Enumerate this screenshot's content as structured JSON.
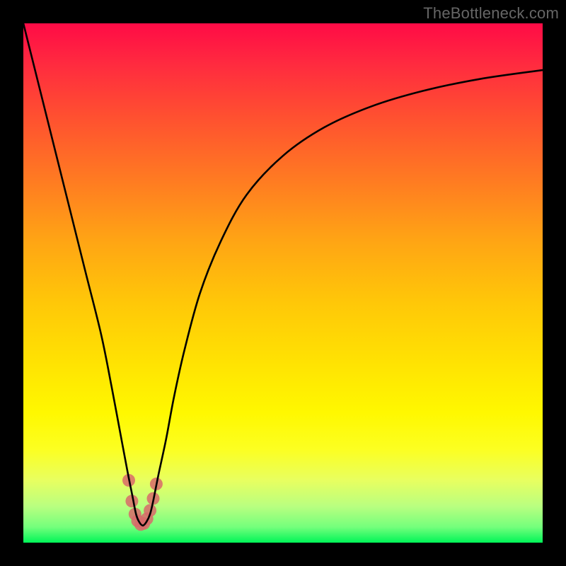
{
  "watermark": "TheBottleneck.com",
  "colors": {
    "frame_bg": "#000000",
    "curve_stroke": "#000000",
    "marker_fill": "#d86a6a",
    "marker_stroke": "#d86a6a"
  },
  "chart_data": {
    "type": "line",
    "title": "",
    "xlabel": "",
    "ylabel": "",
    "xlim": [
      0,
      100
    ],
    "ylim": [
      0,
      100
    ],
    "grid": false,
    "series": [
      {
        "name": "bottleneck-curve",
        "x": [
          0.0,
          3.0,
          6.0,
          9.0,
          12.0,
          15.0,
          17.0,
          18.5,
          20.0,
          21.0,
          21.7,
          22.3,
          23.0,
          23.7,
          24.4,
          25.0,
          26.0,
          27.5,
          29.0,
          31.0,
          34.0,
          38.0,
          43.0,
          50.0,
          58.0,
          67.0,
          77.0,
          88.0,
          100.0
        ],
        "y": [
          100.0,
          88.0,
          76.0,
          64.0,
          52.0,
          40.0,
          30.0,
          22.0,
          14.0,
          9.0,
          5.5,
          4.0,
          3.3,
          4.0,
          5.5,
          8.0,
          13.0,
          20.0,
          28.0,
          37.0,
          48.0,
          58.0,
          67.0,
          74.5,
          80.0,
          84.0,
          87.0,
          89.3,
          91.0
        ]
      }
    ],
    "markers": {
      "name": "highlight-cluster",
      "x": [
        20.3,
        20.9,
        21.5,
        22.0,
        22.6,
        23.2,
        23.8,
        24.4,
        25.0,
        25.6
      ],
      "y": [
        12.0,
        8.0,
        5.5,
        4.2,
        3.5,
        3.7,
        4.6,
        6.2,
        8.5,
        11.3
      ],
      "r": 9
    }
  }
}
